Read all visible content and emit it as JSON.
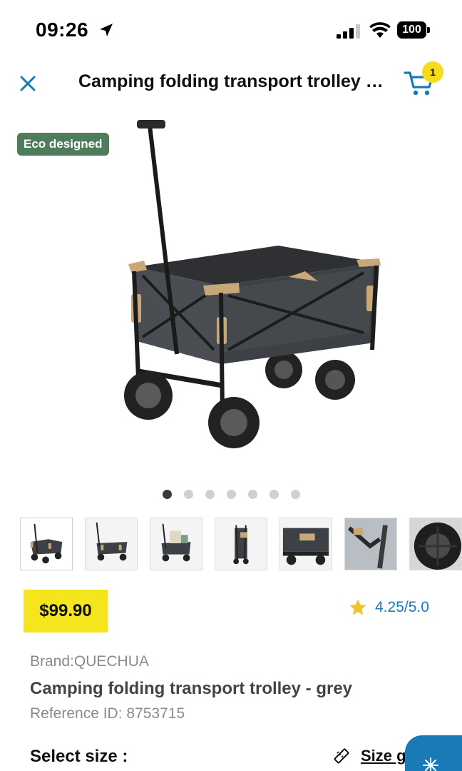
{
  "status_bar": {
    "time": "09:26",
    "battery": "100",
    "icons": [
      "location-arrow-icon",
      "cellular-signal-icon",
      "wifi-icon",
      "battery-icon"
    ]
  },
  "header": {
    "title": "Camping folding transport trolley - grey",
    "close_icon": "close-icon",
    "cart_icon": "cart-icon",
    "cart_count": "1"
  },
  "hero": {
    "badge": "Eco designed",
    "image": "folding-wagon-image"
  },
  "gallery": {
    "image_count": 7,
    "active_index": 0,
    "thumbnails": [
      "thumb-front",
      "thumb-side",
      "thumb-loaded",
      "thumb-folded",
      "thumb-detail",
      "thumb-handle",
      "thumb-wheel"
    ]
  },
  "price": {
    "amount": "$99.90"
  },
  "rating": {
    "value": "4.25/5.0",
    "icon": "star-icon"
  },
  "product": {
    "brand": "Brand:QUECHUA",
    "name": "Camping folding transport trolley - grey",
    "reference": "Reference ID: 8753715"
  },
  "size": {
    "label": "Select size :",
    "guide_label": "Size guide",
    "guide_icon": "ruler-icon"
  },
  "colors": {
    "accent": "#1a7ab8",
    "price_yellow": "#f5e51c",
    "badge_green": "#4f7d5b",
    "cart_badge": "#f5dc1a"
  }
}
